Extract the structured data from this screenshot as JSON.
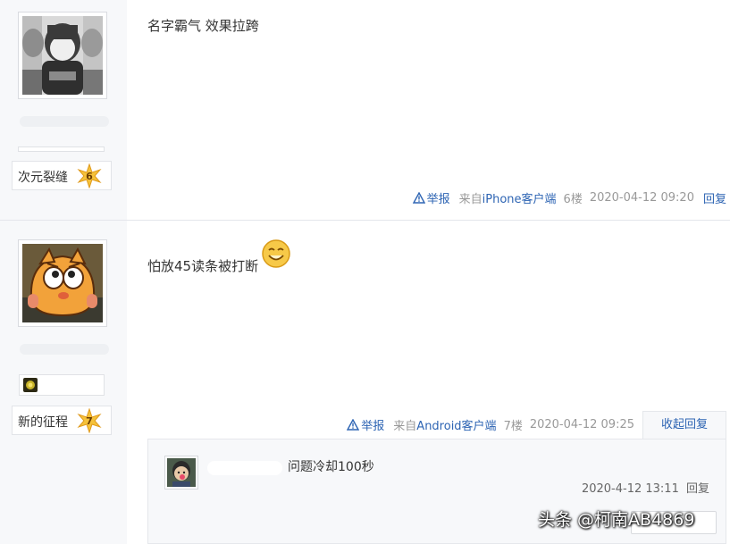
{
  "posts": [
    {
      "author_level_name": "次元裂缝",
      "author_level": "6",
      "content": "名字霸气 效果拉跨",
      "tail": {
        "report_label": "举报",
        "source_prefix": "来自",
        "source_client": "iPhone客户端",
        "floor": "6楼",
        "time": "2020-04-12 09:20",
        "reply_label": "回复"
      }
    },
    {
      "author_level_name": "新的征程",
      "author_level": "7",
      "content": "怕放45读条被打断",
      "tail": {
        "report_label": "举报",
        "source_prefix": "来自",
        "source_client": "Android客户端",
        "floor": "7楼",
        "time": "2020-04-12 09:25",
        "collapse_label": "收起回复"
      },
      "sub_replies": [
        {
          "text": "问题冷却100秒",
          "time": "2020-4-12 13:11",
          "reply_label": "回复"
        }
      ]
    }
  ],
  "watermark": "头条 @柯南AB4869",
  "colors": {
    "link": "#2d64b3",
    "sidebar_bg": "#f7f8fa",
    "meta_grey": "#999999",
    "star_gold": "#f5c23a"
  },
  "icons": {
    "report": "warning-triangle-icon",
    "level": "star-badge-icon",
    "emoji": "smile-emoji-icon",
    "badge": "gold-medal-icon"
  }
}
